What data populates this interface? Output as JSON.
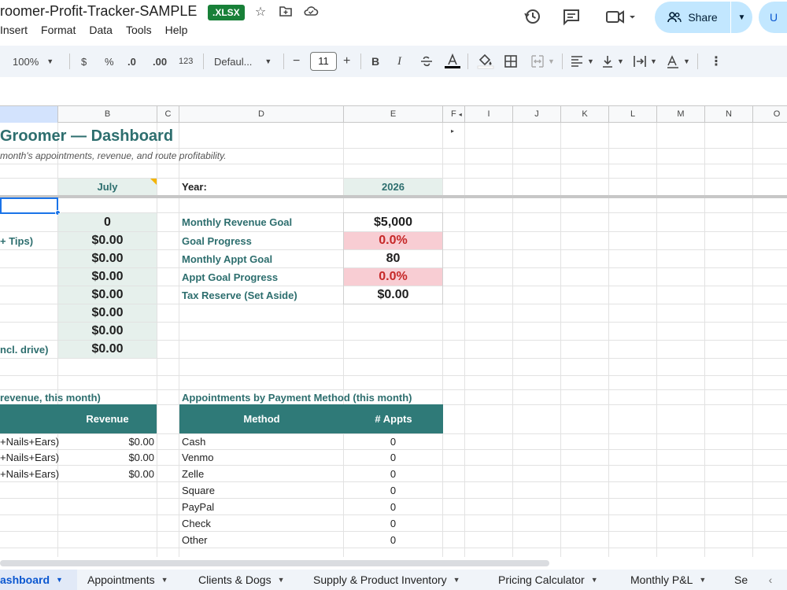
{
  "app": {
    "doc_title": "roomer-Profit-Tracker-SAMPLE",
    "file_badge": ".XLSX",
    "menu": [
      "Insert",
      "Format",
      "Data",
      "Tools",
      "Help"
    ],
    "share_label": "Share",
    "account_initial": "U"
  },
  "toolbar": {
    "zoom": "100%",
    "currency": "$",
    "percent": "%",
    "dec_less": ".0",
    "dec_more": ".00",
    "number_fmt": "123",
    "font": "Defaul...",
    "font_size": "11",
    "minus": "−",
    "plus": "+",
    "bold": "B",
    "italic": "I"
  },
  "columns": [
    {
      "label": "",
      "selected": true
    },
    {
      "label": "B"
    },
    {
      "label": "C"
    },
    {
      "label": "D"
    },
    {
      "label": "E"
    },
    {
      "label": "F"
    },
    {
      "label": "I"
    },
    {
      "label": "J"
    },
    {
      "label": "K"
    },
    {
      "label": "L"
    },
    {
      "label": "M"
    },
    {
      "label": "N"
    },
    {
      "label": "O"
    }
  ],
  "sheet": {
    "title": "Groomer — Dashboard",
    "subtitle": "month's appointments, revenue, and route profitability.",
    "month": "July",
    "year_label": "Year:",
    "year": "2026",
    "left_labels": {
      "tips": "+ Tips)",
      "drive": "ncl. drive)"
    },
    "b_values": [
      "0",
      "$0.00",
      "$0.00",
      "$0.00",
      "$0.00",
      "$0.00",
      "$0.00",
      "$0.00"
    ],
    "goals": [
      {
        "label": "Monthly Revenue Goal",
        "value": "$5,000",
        "style": "plain"
      },
      {
        "label": "Goal Progress",
        "value": "0.0%",
        "style": "pink"
      },
      {
        "label": "Monthly Appt Goal",
        "value": "80",
        "style": "plain"
      },
      {
        "label": "Appt Goal Progress",
        "value": "0.0%",
        "style": "pink"
      },
      {
        "label": "Tax Reserve (Set Aside)",
        "value": "$0.00",
        "style": "plain"
      }
    ],
    "revenue_section": {
      "title": "revenue, this month)",
      "header": "Revenue",
      "rows": [
        {
          "name": "+Nails+Ears)",
          "value": "$0.00"
        },
        {
          "name": "+Nails+Ears)",
          "value": "$0.00"
        },
        {
          "name": "+Nails+Ears)",
          "value": "$0.00"
        }
      ]
    },
    "payment_section": {
      "title": "Appointments by Payment Method (this month)",
      "header_method": "Method",
      "header_count": "# Appts",
      "rows": [
        {
          "method": "Cash",
          "count": "0"
        },
        {
          "method": "Venmo",
          "count": "0"
        },
        {
          "method": "Zelle",
          "count": "0"
        },
        {
          "method": "Square",
          "count": "0"
        },
        {
          "method": "PayPal",
          "count": "0"
        },
        {
          "method": "Check",
          "count": "0"
        },
        {
          "method": "Other",
          "count": "0"
        }
      ]
    }
  },
  "tabs": [
    {
      "label": "ashboard",
      "active": true
    },
    {
      "label": "Appointments"
    },
    {
      "label": "Clients & Dogs"
    },
    {
      "label": "Supply & Product Inventory"
    },
    {
      "label": "Pricing Calculator"
    },
    {
      "label": "Monthly P&L"
    },
    {
      "label": "Se"
    }
  ],
  "colors": {
    "teal_text": "#2d6e6e",
    "teal_header": "#2f7a78",
    "pale_fill": "#e6f0ec",
    "pink_fill": "#f8cdd3",
    "red_text": "#c62828",
    "badge_green": "#188038"
  }
}
